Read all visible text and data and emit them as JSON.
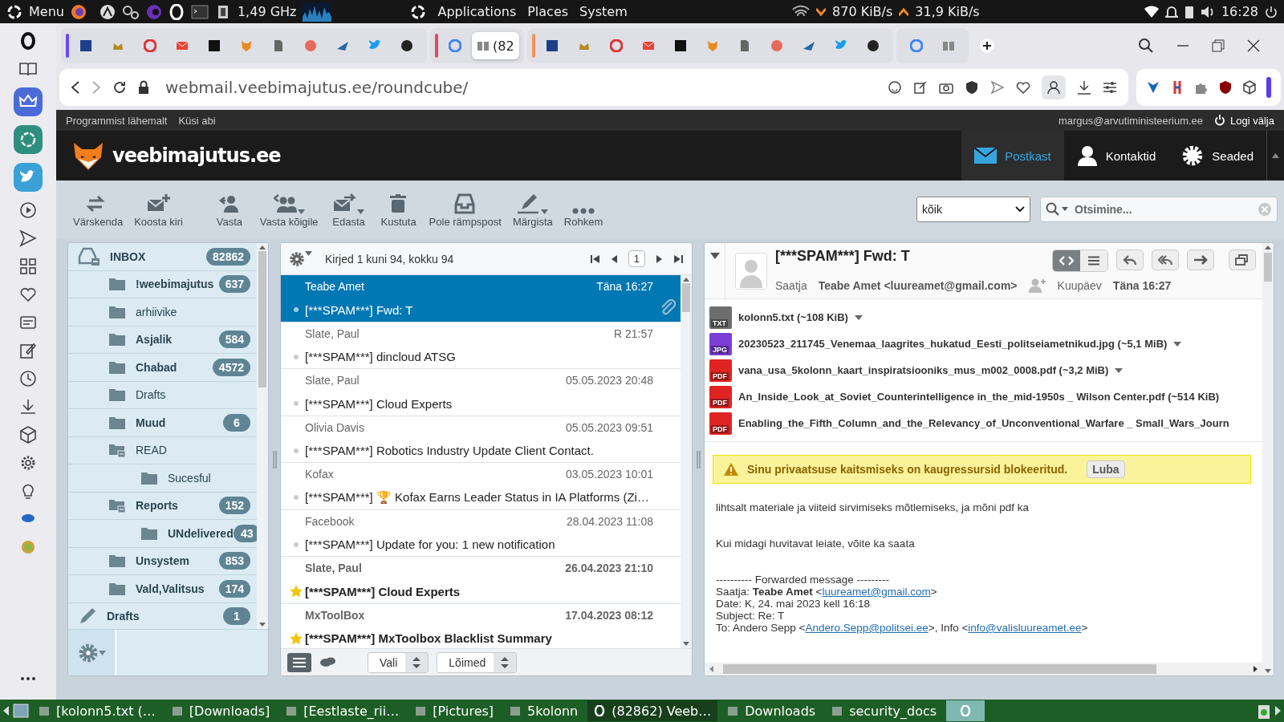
{
  "desktop_panel": {
    "menu": "Menu",
    "cpu": "1,49 GHz",
    "menus": [
      "Applications",
      "Places",
      "System"
    ],
    "net_down": "870 KiB/s",
    "net_up": "31,9 KiB/s",
    "clock": "16:28"
  },
  "browser": {
    "tabs": [
      {
        "selected": false
      },
      {
        "selected": false
      },
      {
        "selected": false
      },
      {
        "selected": false
      },
      {
        "selected": false
      },
      {
        "selected": false
      },
      {
        "selected": false
      },
      {
        "selected": false
      },
      {
        "selected": false
      },
      {
        "selected": false
      },
      {
        "selected": false
      },
      {
        "selected": false
      },
      {
        "label": "(82",
        "selected": true
      },
      {
        "selected": false
      },
      {
        "selected": false
      },
      {
        "selected": false
      },
      {
        "selected": false
      },
      {
        "selected": false
      },
      {
        "selected": false
      },
      {
        "selected": false
      },
      {
        "selected": false
      },
      {
        "selected": false
      },
      {
        "selected": false
      },
      {
        "selected": false
      },
      {
        "selected": false
      },
      {
        "selected": false
      }
    ],
    "url": "webmail.veebimajutus.ee/roundcube/"
  },
  "webmail": {
    "top_links": [
      "Programmist lähemalt",
      "Küsi abi"
    ],
    "user": "margus@arvutiministeerium.ee",
    "logout": "Logi välja",
    "logo": "veebimajutus.ee",
    "nav": [
      {
        "label": "Postkast",
        "kind": "mail",
        "selected": true
      },
      {
        "label": "Kontaktid",
        "kind": "contacts",
        "selected": false
      },
      {
        "label": "Seaded",
        "kind": "settings",
        "selected": false
      }
    ],
    "toolbar": [
      {
        "label": "Värskenda",
        "kind": "refresh",
        "menu": false
      },
      {
        "label": "Koosta kiri",
        "kind": "compose",
        "menu": false
      },
      {
        "label": "Vasta",
        "kind": "reply",
        "menu": false
      },
      {
        "label": "Vasta kõigile",
        "kind": "reply-all",
        "menu": true
      },
      {
        "label": "Edasta",
        "kind": "forward",
        "menu": true
      },
      {
        "label": "Kustuta",
        "kind": "delete",
        "menu": false
      },
      {
        "label": "Pole rämpspost",
        "kind": "not-spam",
        "menu": false
      },
      {
        "label": "Märgista",
        "kind": "mark",
        "menu": true
      },
      {
        "label": "Rohkem",
        "kind": "more",
        "menu": false
      }
    ],
    "filter": "kõik",
    "search": {
      "placeholder": "Otsimine..."
    },
    "folders": [
      {
        "name": "INBOX",
        "kind": "inbox",
        "count": "82862",
        "children": [
          {
            "name": "!weebimajutus",
            "kind": "folder",
            "count": "637"
          },
          {
            "name": "arhiivike",
            "kind": "folder"
          },
          {
            "name": "Asjalik",
            "kind": "folder",
            "count": "584"
          },
          {
            "name": "Chabad",
            "kind": "folder",
            "count": "4572"
          },
          {
            "name": "Drafts",
            "kind": "folder"
          },
          {
            "name": "Muud",
            "kind": "folder",
            "count": "6"
          },
          {
            "name": "READ",
            "kind": "folder",
            "children": [
              {
                "name": "Sucesful",
                "kind": "folder"
              }
            ]
          },
          {
            "name": "Reports",
            "kind": "folder",
            "count": "152",
            "children": [
              {
                "name": "UNdelivered",
                "kind": "folder",
                "count": "43"
              }
            ]
          },
          {
            "name": "Unsystem",
            "kind": "folder",
            "count": "853"
          },
          {
            "name": "Vald,Valitsus",
            "kind": "folder",
            "count": "174"
          }
        ]
      },
      {
        "name": "Drafts",
        "kind": "drafts",
        "count": "1"
      }
    ],
    "message_list": {
      "info": "Kirjed 1 kuni 94, kokku 94",
      "page": "1",
      "messages": [
        {
          "sender": "Teabe Amet",
          "date": "Täna 16:27",
          "subject": "[***SPAM***] Fwd: T",
          "selected": true,
          "unread": false,
          "flagged": false,
          "attachment": true
        },
        {
          "sender": "Slate, Paul",
          "date": "R 21:57",
          "subject": "[***SPAM***] dincloud ATSG",
          "selected": false,
          "unread": false,
          "flagged": false,
          "attachment": false
        },
        {
          "sender": "Slate, Paul",
          "date": "05.05.2023 20:48",
          "subject": "[***SPAM***] Cloud Experts",
          "selected": false,
          "unread": false,
          "flagged": false,
          "attachment": false
        },
        {
          "sender": "Olivia Davis",
          "date": "05.05.2023 09:51",
          "subject": "[***SPAM***] Robotics Industry Update Client Contact.",
          "selected": false,
          "unread": false,
          "flagged": false,
          "attachment": false
        },
        {
          "sender": "Kofax",
          "date": "03.05.2023 10:01",
          "subject": "[***SPAM***] 🏆 Kofax Earns Leader Status in IA Platforms (Zi…",
          "selected": false,
          "unread": false,
          "flagged": false,
          "attachment": false
        },
        {
          "sender": "Facebook",
          "date": "28.04.2023 11:08",
          "subject": "[***SPAM***] Update for you: 1 new notification",
          "selected": false,
          "unread": false,
          "flagged": false,
          "attachment": false
        },
        {
          "sender": "Slate, Paul",
          "date": "26.04.2023 21:10",
          "subject": "[***SPAM***] Cloud Experts",
          "selected": false,
          "unread": true,
          "flagged": true,
          "attachment": false
        },
        {
          "sender": "MxToolBox",
          "date": "17.04.2023 08:12",
          "subject": "[***SPAM***] MxToolbox Blacklist Summary",
          "selected": false,
          "unread": true,
          "flagged": true,
          "attachment": false
        }
      ],
      "footer": {
        "select": "Vali",
        "threads": "Lõimed"
      }
    },
    "preview": {
      "subject": "[***SPAM***] Fwd: T",
      "from_label": "Saatja",
      "from": "Teabe Amet <luureamet@gmail.com>",
      "date_label": "Kuupäev",
      "date": "Täna 16:27",
      "attachments": [
        {
          "kind": "txt",
          "badge": "TXT",
          "name": "kolonn5.txt (~108 KiB)",
          "menu": true
        },
        {
          "kind": "jpg",
          "badge": "JPG",
          "name": "20230523_211745_Venemaa_laagrites_hukatud_Eesti_politseiametnikud.jpg (~5,1 MiB)",
          "menu": true
        },
        {
          "kind": "pdf",
          "badge": "PDF",
          "name": "vana_usa_5kolonn_kaart_inspiratsiooniks_mus_m002_0008.pdf (~3,2 MiB)",
          "menu": true
        },
        {
          "kind": "pdf",
          "badge": "PDF",
          "name": "An_Inside_Look_at_Soviet_Counterintelligence in_the_mid-1950s _ Wilson Center.pdf (~514 KiB)",
          "menu": false
        },
        {
          "kind": "pdf",
          "badge": "PDF",
          "name": "Enabling_the_Fifth_Column_and_the_Relevancy_of_Unconventional_Warfare _ Small_Wars_Journ",
          "menu": false
        }
      ],
      "warning": "Sinu privaatsuse kaitsmiseks on kaugressursid blokeeritud.",
      "allow": "Luba",
      "body": [
        "lihtsalt materiale ja viiteid sirvimiseks mõtlemiseks, ja mõni pdf ka",
        "Kui midagi huvitavat leiate, võite ka saata"
      ],
      "forwarded": [
        [
          {
            "text": "---------- Forwarded message ---------"
          }
        ],
        [
          {
            "text": "Saatja: **Teabe Amet** <"
          },
          {
            "link": "luureamet@gmail.com"
          },
          {
            "text": ">"
          }
        ],
        [
          {
            "text": "Date: K, 24. mai 2023 kell 16:18"
          }
        ],
        [
          {
            "text": "Subject: Re: T"
          }
        ],
        [
          {
            "text": "To: Andero Sepp <"
          },
          {
            "link": "Andero.Sepp@politsei.ee"
          },
          {
            "text": ">, Info <"
          },
          {
            "link": "info@valisluureamet.ee"
          },
          {
            "text": ">"
          }
        ]
      ]
    }
  },
  "taskbar": {
    "items": [
      {
        "label": "[kolonn5.txt (…",
        "selected": false
      },
      {
        "label": "[Downloads]",
        "selected": false
      },
      {
        "label": "[Eestlaste_rii…",
        "selected": false
      },
      {
        "label": "[Pictures]",
        "selected": false
      },
      {
        "label": "5kolonn",
        "selected": false
      },
      {
        "label": "(82862) Veeb…",
        "selected": false
      },
      {
        "label": "Downloads",
        "selected": false
      },
      {
        "label": "security_docs",
        "selected": false
      },
      {
        "selected": true
      }
    ]
  }
}
